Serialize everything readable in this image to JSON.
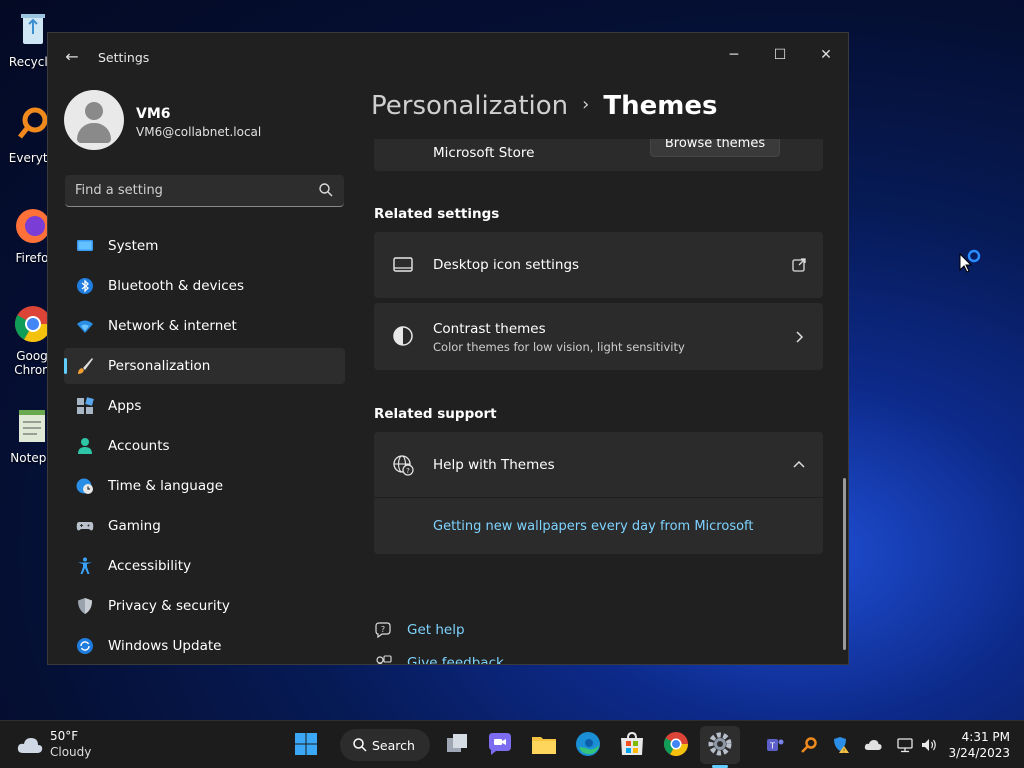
{
  "desktop": {
    "icons": [
      {
        "label": "Recycle",
        "icon": "recycle-bin-icon"
      },
      {
        "label": "Everyth",
        "icon": "everything-search-icon"
      },
      {
        "label": "Firefo",
        "icon": "firefox-icon"
      },
      {
        "label": "Goog\nChron",
        "icon": "chrome-icon"
      },
      {
        "label": "Notepa",
        "icon": "notepad-icon"
      }
    ]
  },
  "window": {
    "title": "Settings",
    "controls": {
      "minimize": "─",
      "maximize": "☐",
      "close": "✕"
    },
    "back": "←"
  },
  "profile": {
    "name": "VM6",
    "email": "VM6@collabnet.local"
  },
  "search": {
    "placeholder": "Find a setting"
  },
  "nav": {
    "items": [
      {
        "label": "System",
        "icon": "system-icon"
      },
      {
        "label": "Bluetooth & devices",
        "icon": "bluetooth-icon"
      },
      {
        "label": "Network & internet",
        "icon": "wifi-icon"
      },
      {
        "label": "Personalization",
        "icon": "brush-icon"
      },
      {
        "label": "Apps",
        "icon": "apps-icon"
      },
      {
        "label": "Accounts",
        "icon": "account-icon"
      },
      {
        "label": "Time & language",
        "icon": "globe-clock-icon"
      },
      {
        "label": "Gaming",
        "icon": "gamepad-icon"
      },
      {
        "label": "Accessibility",
        "icon": "accessibility-icon"
      },
      {
        "label": "Privacy & security",
        "icon": "shield-icon"
      },
      {
        "label": "Windows Update",
        "icon": "update-icon"
      }
    ],
    "active": "Personalization"
  },
  "breadcrumb": {
    "parent": "Personalization",
    "separator": "›",
    "current": "Themes"
  },
  "store_card": {
    "title": "Microsoft Store",
    "button": "Browse themes"
  },
  "related_settings": {
    "heading": "Related settings",
    "items": [
      {
        "title": "Desktop icon settings",
        "icon": "desktop-icon",
        "trail": "external-link-icon"
      },
      {
        "title": "Contrast themes",
        "subtitle": "Color themes for low vision, light sensitivity",
        "icon": "contrast-icon",
        "trail": "chevron-right-icon"
      }
    ]
  },
  "related_support": {
    "heading": "Related support",
    "help": {
      "title": "Help with Themes",
      "icon": "globe-help-icon",
      "trail": "chevron-up-icon"
    },
    "link": "Getting new wallpapers every day from Microsoft"
  },
  "footer_links": [
    {
      "label": "Get help",
      "icon": "help-icon"
    },
    {
      "label": "Give feedback",
      "icon": "feedback-icon"
    }
  ],
  "taskbar": {
    "weather": {
      "temp": "50°F",
      "desc": "Cloudy"
    },
    "search_label": "Search",
    "clock": {
      "time": "4:31 PM",
      "date": "3/24/2023"
    }
  },
  "colors": {
    "accent": "#60cdff",
    "link": "#7ed3ff",
    "card": "#2b2b2b",
    "window": "#202020"
  }
}
